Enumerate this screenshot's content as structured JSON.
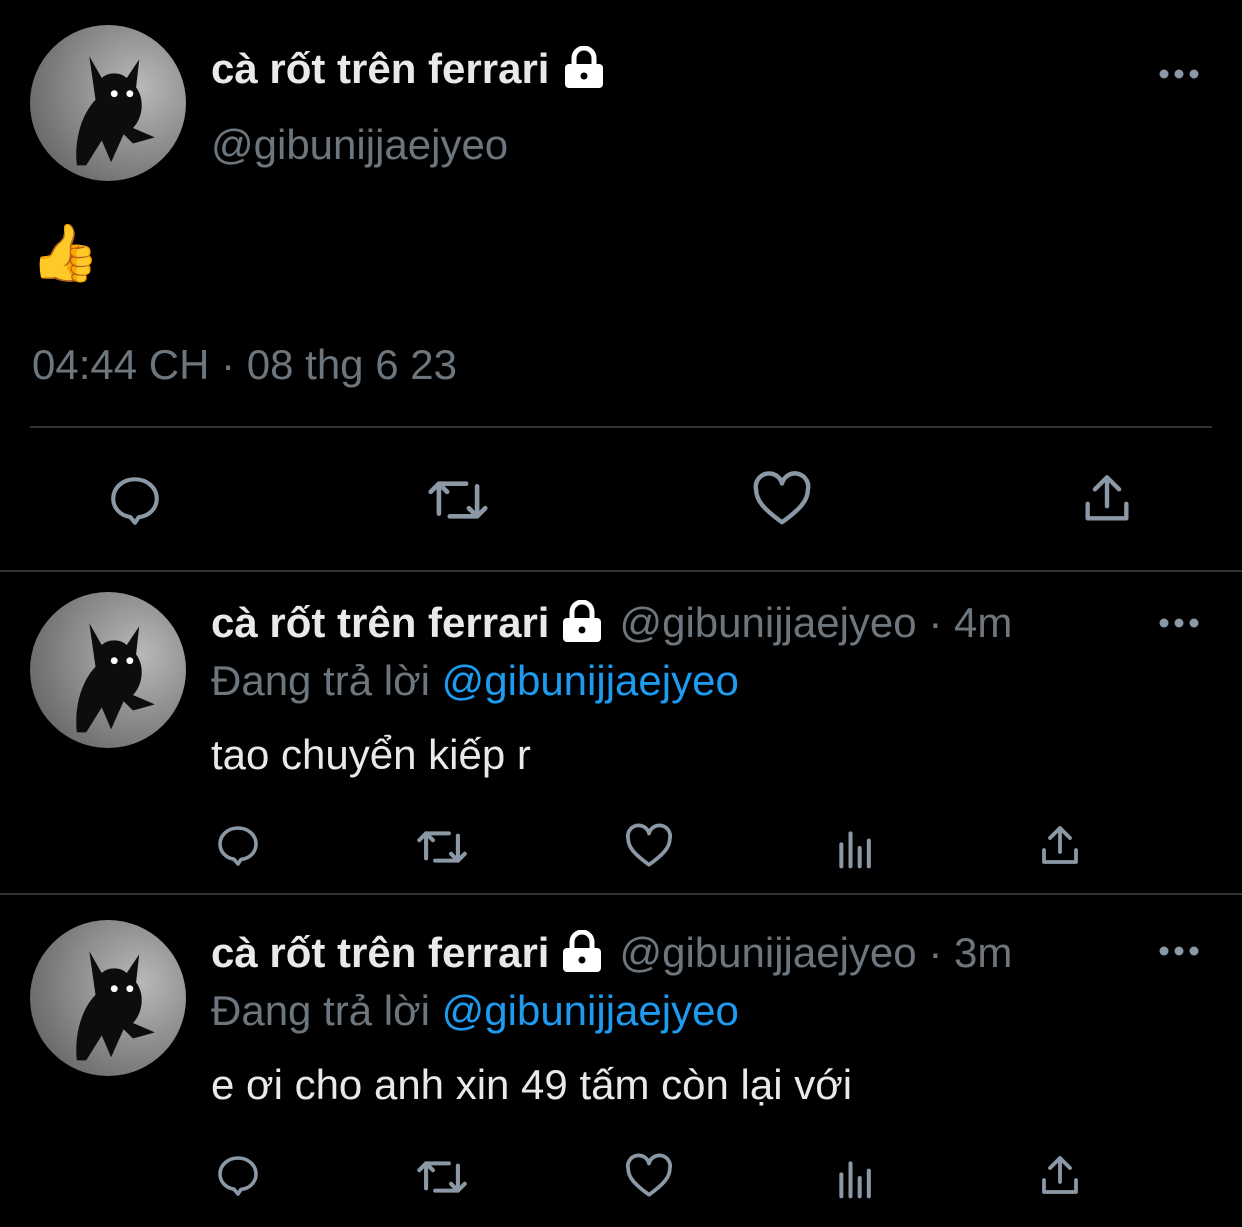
{
  "main_tweet": {
    "author_name": "cà rốt trên ferrari",
    "author_handle": "@gibunijjaejyeo",
    "lock_icon": "lock-icon",
    "body": "👍",
    "timestamp": "04:44 CH · 08 thg 6 23",
    "actions": [
      "reply-icon",
      "retweet-icon",
      "like-icon",
      "share-icon"
    ]
  },
  "replies": [
    {
      "author_name": "cà rốt trên ferrari",
      "author_handle": "@gibunijjaejyeo",
      "separator_time": "· 4m",
      "replying_label": "Đang trả lời",
      "replying_to": "@gibunijjaejyeo",
      "body": "tao chuyển kiếp r",
      "actions": [
        "reply-icon",
        "retweet-icon",
        "like-icon",
        "analytics-icon",
        "share-icon"
      ]
    },
    {
      "author_name": "cà rốt trên ferrari",
      "author_handle": "@gibunijjaejyeo",
      "separator_time": "· 3m",
      "replying_label": "Đang trả lời",
      "replying_to": "@gibunijjaejyeo",
      "body": "e ơi cho anh xin 49 tấm còn lại với",
      "actions": [
        "reply-icon",
        "retweet-icon",
        "like-icon",
        "analytics-icon",
        "share-icon"
      ]
    }
  ],
  "colors": {
    "background": "#000000",
    "text": "#e7e9ea",
    "muted": "#6e767d",
    "link": "#1d9bf0",
    "divider": "#2f3336"
  }
}
